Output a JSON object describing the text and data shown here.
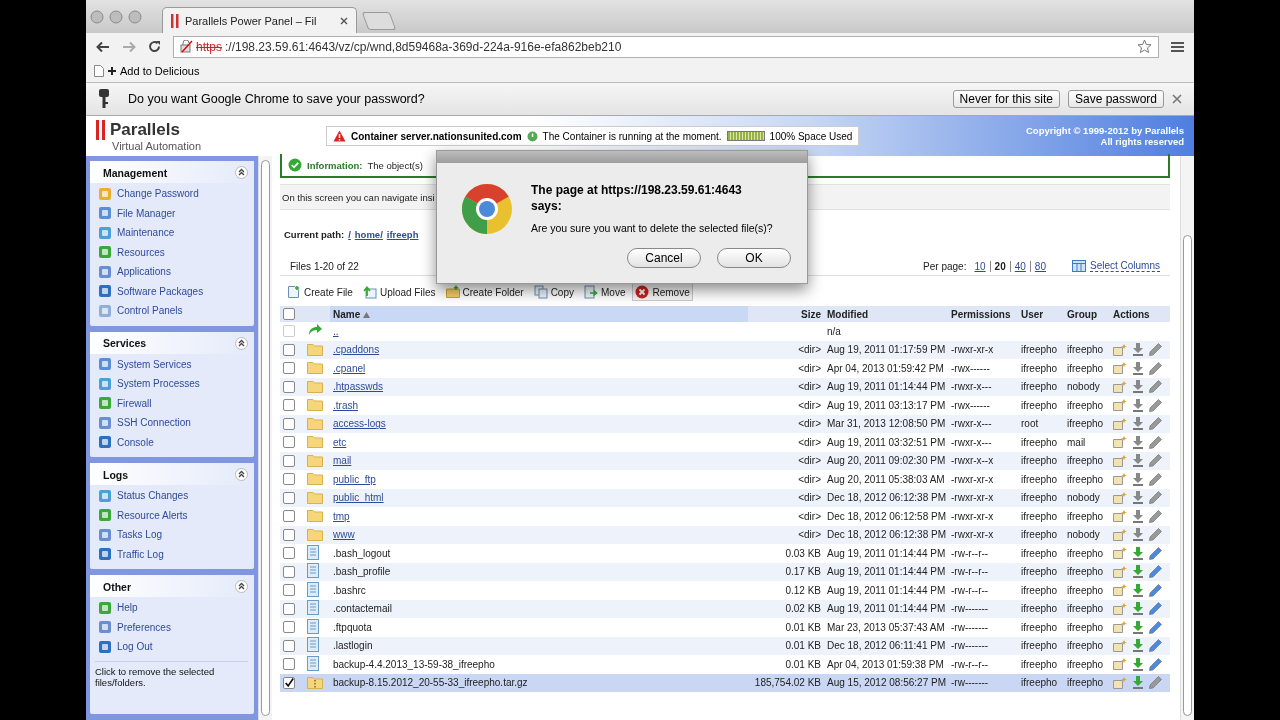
{
  "browser": {
    "tab_title": "Parallels Power Panel – Fil",
    "url_scheme": "https",
    "url_rest": "://198.23.59.61:4643/vz/cp/wnd,8d59468a-369d-224a-916e-efa862beb210",
    "bookmark": "Add to Delicious"
  },
  "infobar": {
    "message": "Do you want Google Chrome to save your password?",
    "buttons": [
      "Never for this site",
      "Save password"
    ]
  },
  "header": {
    "logo": "Parallels",
    "subtitle": "Virtual Automation",
    "container_label": "Container server.nationsunited.com",
    "status": "The Container is running at the moment.",
    "space_meter": {
      "level": 1
    },
    "space_text": "100% Space Used",
    "copyright": [
      "Copyright © 1999-2012 by Parallels",
      "All rights reserved"
    ]
  },
  "sidebar": {
    "sections": [
      {
        "title": "Management",
        "expanded": true,
        "items": [
          "Change Password",
          "File Manager",
          "Maintenance",
          "Resources",
          "Applications",
          "Software Packages",
          "Control Panels"
        ]
      },
      {
        "title": "Services",
        "expanded": true,
        "items": [
          "System Services",
          "System Processes",
          "Firewall",
          "SSH Connection",
          "Console"
        ]
      },
      {
        "title": "Logs",
        "expanded": true,
        "items": [
          "Status Changes",
          "Resource Alerts",
          "Tasks Log",
          "Traffic Log"
        ]
      },
      {
        "title": "Other",
        "expanded": true,
        "items": [
          "Help",
          "Preferences",
          "Log Out"
        ]
      }
    ],
    "hint": "Click to remove the selected files/folders."
  },
  "main": {
    "info_label": "Information:",
    "info_text": "The object(s)",
    "description": "On this screen you can navigate insi",
    "path_label": "Current path:",
    "path": [
      "/",
      "home/",
      "ifreeph"
    ],
    "files_count": "Files 1-20 of 22",
    "per_page_label": "Per page:",
    "per_page": [
      {
        "label": "10",
        "selected": false
      },
      {
        "label": "20",
        "selected": true
      },
      {
        "label": "40",
        "selected": false
      },
      {
        "label": "80",
        "selected": false
      }
    ],
    "select_columns": "Select Columns",
    "toolbar": [
      {
        "kind": "new-file",
        "label": "Create File",
        "hovered": false
      },
      {
        "kind": "upload",
        "label": "Upload Files",
        "hovered": false
      },
      {
        "kind": "new-folder",
        "label": "Create Folder",
        "hovered": false
      },
      {
        "kind": "copy",
        "label": "Copy",
        "hovered": false
      },
      {
        "kind": "move",
        "label": "Move",
        "hovered": false
      },
      {
        "kind": "remove",
        "label": "Remove",
        "hovered": true
      }
    ],
    "select_all_checked": false,
    "columns": [
      "Name",
      "Size",
      "Modified",
      "Permissions",
      "User",
      "Group",
      "Actions"
    ],
    "rows": [
      {
        "kind": "parent",
        "name": "..",
        "modified": "n/a",
        "checked": false
      },
      {
        "kind": "dir",
        "name": ".cpaddons",
        "size": "<dir>",
        "modified": "Aug 19, 2011 01:17:59 PM",
        "permissions": "-rwxr-xr-x",
        "user": "ifreepho",
        "group": "ifreepho",
        "checked": false
      },
      {
        "kind": "dir",
        "name": ".cpanel",
        "size": "<dir>",
        "modified": "Apr 04, 2013 01:59:42 PM",
        "permissions": "-rwx------",
        "user": "ifreepho",
        "group": "ifreepho",
        "checked": false
      },
      {
        "kind": "dir",
        "name": ".htpasswds",
        "size": "<dir>",
        "modified": "Aug 19, 2011 01:14:44 PM",
        "permissions": "-rwxr-x---",
        "user": "ifreepho",
        "group": "nobody",
        "checked": false
      },
      {
        "kind": "dir",
        "name": ".trash",
        "size": "<dir>",
        "modified": "Aug 19, 2011 03:13:17 PM",
        "permissions": "-rwx------",
        "user": "ifreepho",
        "group": "ifreepho",
        "checked": false
      },
      {
        "kind": "dir",
        "name": "access-logs",
        "size": "<dir>",
        "modified": "Mar 31, 2013 12:08:50 PM",
        "permissions": "-rwxr-x---",
        "user": "root",
        "group": "ifreepho",
        "checked": false
      },
      {
        "kind": "dir",
        "name": "etc",
        "size": "<dir>",
        "modified": "Aug 19, 2011 03:32:51 PM",
        "permissions": "-rwxr-x---",
        "user": "ifreepho",
        "group": "mail",
        "checked": false
      },
      {
        "kind": "dir",
        "name": "mail",
        "size": "<dir>",
        "modified": "Aug 20, 2011 09:02:30 PM",
        "permissions": "-rwxr-x--x",
        "user": "ifreepho",
        "group": "ifreepho",
        "checked": false
      },
      {
        "kind": "dir",
        "name": "public_ftp",
        "size": "<dir>",
        "modified": "Aug 20, 2011 05:38:03 AM",
        "permissions": "-rwxr-xr-x",
        "user": "ifreepho",
        "group": "ifreepho",
        "checked": false
      },
      {
        "kind": "dir",
        "name": "public_html",
        "size": "<dir>",
        "modified": "Dec 18, 2012 06:12:38 PM",
        "permissions": "-rwxr-xr-x",
        "user": "ifreepho",
        "group": "nobody",
        "checked": false
      },
      {
        "kind": "dir",
        "name": "tmp",
        "size": "<dir>",
        "modified": "Dec 18, 2012 06:12:58 PM",
        "permissions": "-rwxr-xr-x",
        "user": "ifreepho",
        "group": "ifreepho",
        "checked": false
      },
      {
        "kind": "dir",
        "name": "www",
        "size": "<dir>",
        "modified": "Dec 18, 2012 06:12:38 PM",
        "permissions": "-rwxr-xr-x",
        "user": "ifreepho",
        "group": "nobody",
        "checked": false
      },
      {
        "kind": "file",
        "name": ".bash_logout",
        "size": "0.03 KB",
        "modified": "Aug 19, 2011 01:14:44 PM",
        "permissions": "-rw-r--r--",
        "user": "ifreepho",
        "group": "ifreepho",
        "checked": false
      },
      {
        "kind": "file",
        "name": ".bash_profile",
        "size": "0.17 KB",
        "modified": "Aug 19, 2011 01:14:44 PM",
        "permissions": "-rw-r--r--",
        "user": "ifreepho",
        "group": "ifreepho",
        "checked": false
      },
      {
        "kind": "file",
        "name": ".bashrc",
        "size": "0.12 KB",
        "modified": "Aug 19, 2011 01:14:44 PM",
        "permissions": "-rw-r--r--",
        "user": "ifreepho",
        "group": "ifreepho",
        "checked": false
      },
      {
        "kind": "file",
        "name": ".contactemail",
        "size": "0.02 KB",
        "modified": "Aug 19, 2011 01:14:44 PM",
        "permissions": "-rw-------",
        "user": "ifreepho",
        "group": "ifreepho",
        "checked": false
      },
      {
        "kind": "file",
        "name": ".ftpquota",
        "size": "0.01 KB",
        "modified": "Mar 23, 2013 05:37:43 AM",
        "permissions": "-rw-------",
        "user": "ifreepho",
        "group": "ifreepho",
        "checked": false
      },
      {
        "kind": "file",
        "name": ".lastlogin",
        "size": "0.01 KB",
        "modified": "Dec 18, 2012 06:11:41 PM",
        "permissions": "-rw-------",
        "user": "ifreepho",
        "group": "ifreepho",
        "checked": false
      },
      {
        "kind": "file",
        "name": "backup-4.4.2013_13-59-38_ifreepho",
        "size": "0.01 KB",
        "modified": "Apr 04, 2013 01:59:38 PM",
        "permissions": "-rw-r--r--",
        "user": "ifreepho",
        "group": "ifreepho",
        "checked": false
      },
      {
        "kind": "archive",
        "name": "backup-8.15.2012_20-55-33_ifreepho.tar.gz",
        "size": "185,754.02 KB",
        "modified": "Aug 15, 2012 08:56:27 PM",
        "permissions": "-rw-------",
        "user": "ifreepho",
        "group": "ifreepho",
        "checked": true
      }
    ]
  },
  "dialog": {
    "title": "The page at https://198.23.59.61:4643 says:",
    "message": "Are you sure you want to delete the selected file(s)?",
    "buttons": [
      "Cancel",
      "OK"
    ]
  }
}
